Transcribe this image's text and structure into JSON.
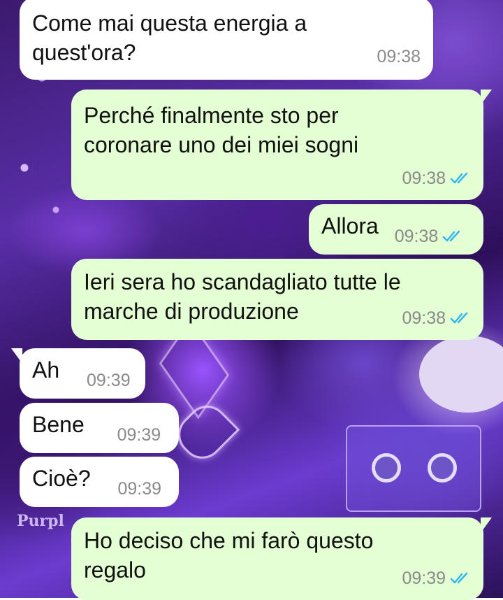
{
  "colors": {
    "incoming_bubble": "#ffffff",
    "outgoing_bubble": "#e4ffd4",
    "timestamp": "#8a8a8a",
    "read_ticks": "#34b7f1"
  },
  "wallpaper": {
    "sign_text": "Purpl"
  },
  "messages": [
    {
      "direction": "in",
      "text": "Come mai questa energia a\nquest'ora?",
      "time": "09:38"
    },
    {
      "direction": "out",
      "text": "Perché finalmente sto per\ncoronare uno dei miei sogni",
      "time": "09:38",
      "status": "read"
    },
    {
      "direction": "out",
      "text": "Allora",
      "time": "09:38",
      "status": "read"
    },
    {
      "direction": "out",
      "text": "Ieri sera ho scandagliato tutte le\nmarche di produzione",
      "time": "09:38",
      "status": "read"
    },
    {
      "direction": "in",
      "text": "Ah",
      "time": "09:39"
    },
    {
      "direction": "in",
      "text": "Bene",
      "time": "09:39"
    },
    {
      "direction": "in",
      "text": "Cioè?",
      "time": "09:39"
    },
    {
      "direction": "out",
      "text": "Ho deciso che mi farò questo\nregalo",
      "time": "09:39",
      "status": "read"
    }
  ]
}
